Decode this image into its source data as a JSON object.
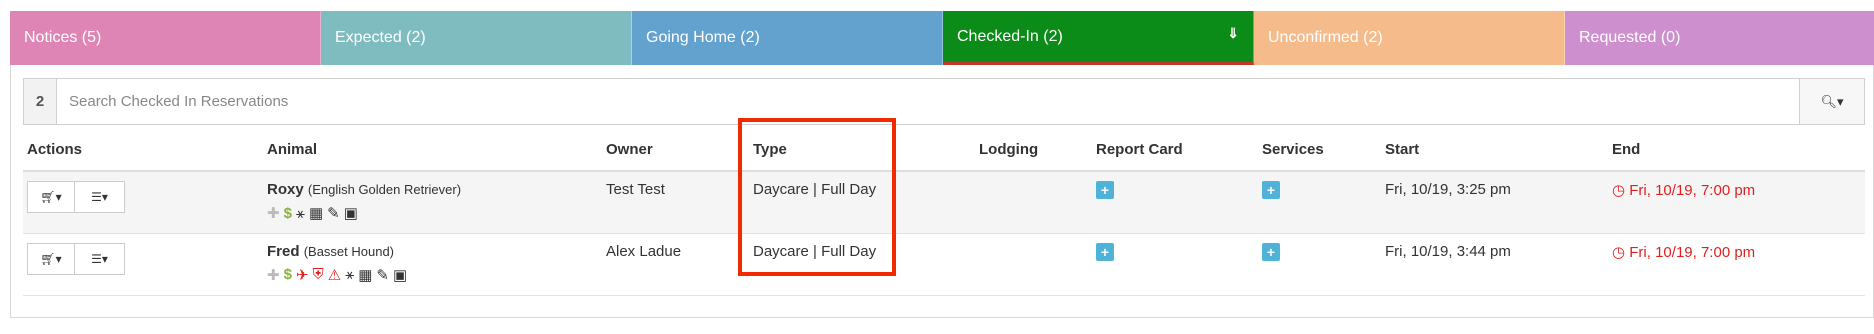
{
  "tabs": [
    {
      "label": "Notices (5)",
      "color": "#de85b5"
    },
    {
      "label": "Expected (2)",
      "color": "#7ebcbf"
    },
    {
      "label": "Going Home (2)",
      "color": "#63a1cf"
    },
    {
      "label": "Checked-In (2)",
      "color": "#0b8b18",
      "active": true,
      "chevron": "double-chevron-down-icon"
    },
    {
      "label": "Unconfirmed (2)",
      "color": "#f6bb8b"
    },
    {
      "label": "Requested (0)",
      "color": "#cd8fcd"
    }
  ],
  "search": {
    "count": "2",
    "placeholder": "Search Checked In Reservations",
    "button_icon": "search-icon"
  },
  "table": {
    "headers": [
      "Actions",
      "Animal",
      "Owner",
      "Type",
      "Lodging",
      "Report Card",
      "Services",
      "Start",
      "End"
    ],
    "rows": [
      {
        "name": "Roxy",
        "breed": "(English Golden Retriever)",
        "owner": "Test Test",
        "type": "Daycare | Full Day",
        "lodging": "",
        "start": "Fri, 10/19, 3:25 pm",
        "end": "Fri, 10/19, 7:00 pm"
      },
      {
        "name": "Fred",
        "breed": "(Basset Hound)",
        "owner": "Alex Ladue",
        "type": "Daycare | Full Day",
        "lodging": "",
        "start": "Fri, 10/19, 3:44 pm",
        "end": "Fri, 10/19, 7:00 pm"
      }
    ]
  },
  "accent": {
    "highlight": "#f22a00",
    "end_time": "#e02020",
    "plus_button": "#4fb3d9"
  }
}
